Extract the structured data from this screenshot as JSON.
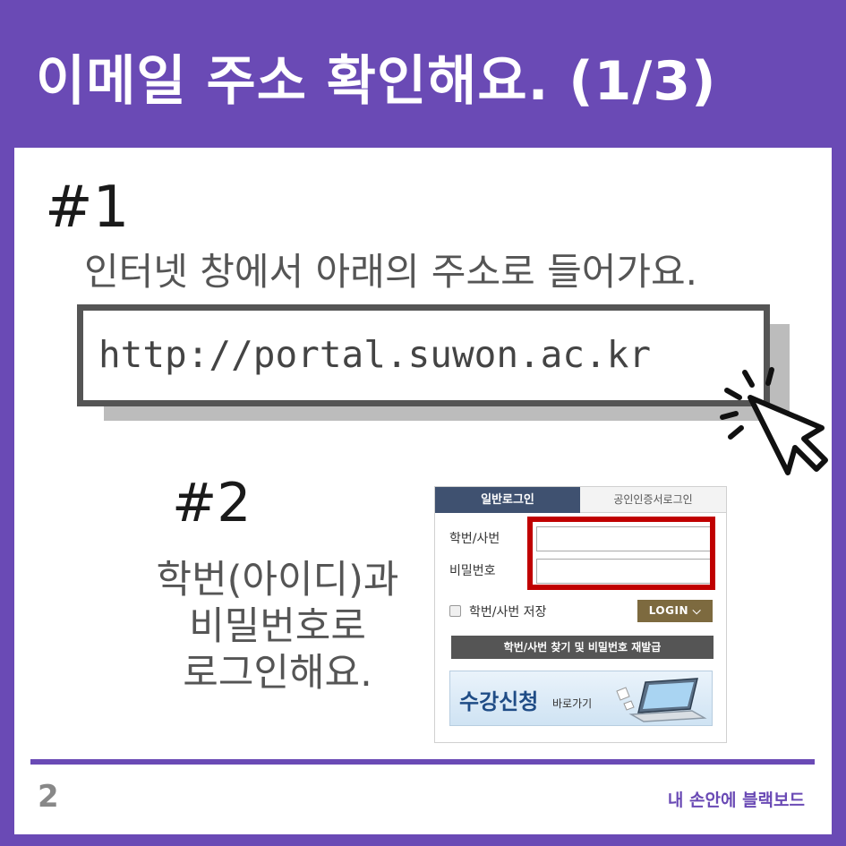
{
  "title": "이메일 주소 확인해요. (1/3)",
  "step1": {
    "number": "#1",
    "text": "인터넷 창에서 아래의 주소로 들어가요.",
    "url": "http://portal.suwon.ac.kr"
  },
  "step2": {
    "number": "#2",
    "lines": [
      "학번(아이디)과",
      "비밀번호로",
      "로그인해요."
    ]
  },
  "login": {
    "tab_general": "일반로그인",
    "tab_cert": "공인인증서로그인",
    "id_label": "학번/사번",
    "pw_label": "비밀번호",
    "save_label": "학번/사번 저장",
    "login_button": "LOGIN",
    "find_button": "학번/사번 찾기 및 비밀번호 재발급",
    "banner_main": "수강신청",
    "banner_sub": "바로가기"
  },
  "footer": {
    "page_number": "2",
    "brand": "내 손안에 블랙보드"
  },
  "colors": {
    "brand_purple": "#6a4ab5",
    "highlight_red": "#c00000",
    "tab_navy": "#3f5170",
    "login_gold": "#7d6a3f"
  }
}
